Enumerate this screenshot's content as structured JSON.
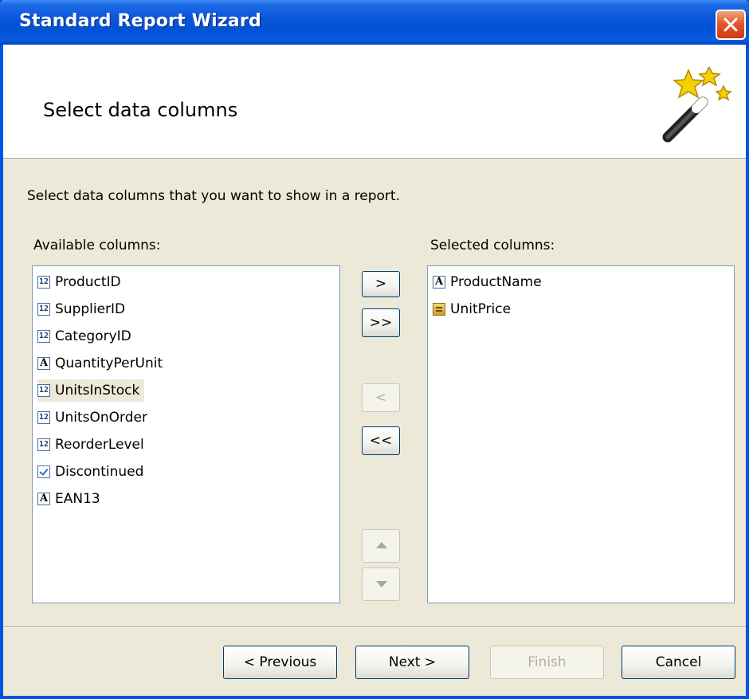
{
  "window": {
    "title": "Standard Report Wizard"
  },
  "header": {
    "title": "Select data columns",
    "icon": "magic-wand-icon"
  },
  "description": "Select data columns that you want to show in a report.",
  "available": {
    "label": "Available columns:",
    "items": [
      {
        "label": "ProductID",
        "type": "number"
      },
      {
        "label": "SupplierID",
        "type": "number"
      },
      {
        "label": "CategoryID",
        "type": "number"
      },
      {
        "label": "QuantityPerUnit",
        "type": "string"
      },
      {
        "label": "UnitsInStock",
        "type": "number"
      },
      {
        "label": "UnitsOnOrder",
        "type": "number"
      },
      {
        "label": "ReorderLevel",
        "type": "number"
      },
      {
        "label": "Discontinued",
        "type": "boolean"
      },
      {
        "label": "EAN13",
        "type": "string"
      }
    ],
    "highlighted": "UnitsInStock"
  },
  "selected": {
    "label": "Selected columns:",
    "items": [
      {
        "label": "ProductName",
        "type": "string"
      },
      {
        "label": "UnitPrice",
        "type": "currency"
      }
    ]
  },
  "move_buttons": {
    "add": ">",
    "add_all": ">>",
    "remove": "<",
    "remove_all": "<<"
  },
  "icon_glyphs": {
    "number": "12",
    "string": "A"
  },
  "footer": {
    "previous": "< Previous",
    "next": "Next >",
    "finish": "Finish",
    "cancel": "Cancel"
  },
  "colors": {
    "titlebar": "#0054e3",
    "window_bg": "#ece9d8",
    "close": "#e2582c"
  }
}
